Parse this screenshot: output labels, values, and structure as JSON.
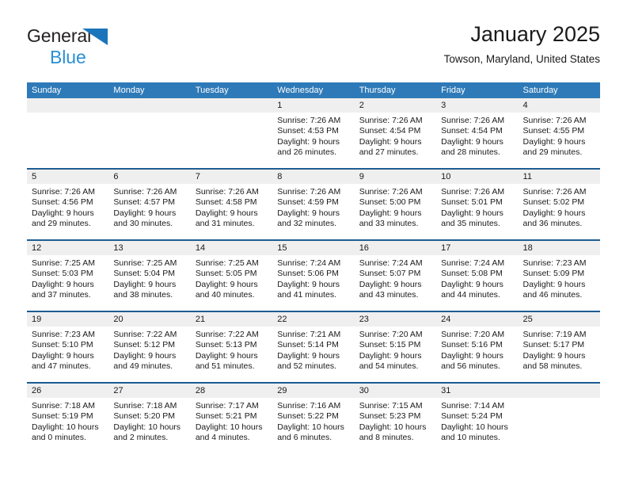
{
  "brand": {
    "word1": "General",
    "word2": "Blue",
    "triangle_color": "#1b75bb",
    "blue_text_color": "#2a8fd4"
  },
  "header": {
    "title": "January 2025",
    "subtitle": "Towson, Maryland, United States"
  },
  "colors": {
    "header_blue": "#2e7ab8",
    "row_divider": "#1f5c91",
    "date_strip_gray": "#efeff0",
    "text": "#1a1a1a"
  },
  "weekdays": [
    "Sunday",
    "Monday",
    "Tuesday",
    "Wednesday",
    "Thursday",
    "Friday",
    "Saturday"
  ],
  "weeks": [
    [
      {
        "day": "",
        "lines": []
      },
      {
        "day": "",
        "lines": []
      },
      {
        "day": "",
        "lines": []
      },
      {
        "day": "1",
        "lines": [
          "Sunrise: 7:26 AM",
          "Sunset: 4:53 PM",
          "Daylight: 9 hours",
          "and 26 minutes."
        ]
      },
      {
        "day": "2",
        "lines": [
          "Sunrise: 7:26 AM",
          "Sunset: 4:54 PM",
          "Daylight: 9 hours",
          "and 27 minutes."
        ]
      },
      {
        "day": "3",
        "lines": [
          "Sunrise: 7:26 AM",
          "Sunset: 4:54 PM",
          "Daylight: 9 hours",
          "and 28 minutes."
        ]
      },
      {
        "day": "4",
        "lines": [
          "Sunrise: 7:26 AM",
          "Sunset: 4:55 PM",
          "Daylight: 9 hours",
          "and 29 minutes."
        ]
      }
    ],
    [
      {
        "day": "5",
        "lines": [
          "Sunrise: 7:26 AM",
          "Sunset: 4:56 PM",
          "Daylight: 9 hours",
          "and 29 minutes."
        ]
      },
      {
        "day": "6",
        "lines": [
          "Sunrise: 7:26 AM",
          "Sunset: 4:57 PM",
          "Daylight: 9 hours",
          "and 30 minutes."
        ]
      },
      {
        "day": "7",
        "lines": [
          "Sunrise: 7:26 AM",
          "Sunset: 4:58 PM",
          "Daylight: 9 hours",
          "and 31 minutes."
        ]
      },
      {
        "day": "8",
        "lines": [
          "Sunrise: 7:26 AM",
          "Sunset: 4:59 PM",
          "Daylight: 9 hours",
          "and 32 minutes."
        ]
      },
      {
        "day": "9",
        "lines": [
          "Sunrise: 7:26 AM",
          "Sunset: 5:00 PM",
          "Daylight: 9 hours",
          "and 33 minutes."
        ]
      },
      {
        "day": "10",
        "lines": [
          "Sunrise: 7:26 AM",
          "Sunset: 5:01 PM",
          "Daylight: 9 hours",
          "and 35 minutes."
        ]
      },
      {
        "day": "11",
        "lines": [
          "Sunrise: 7:26 AM",
          "Sunset: 5:02 PM",
          "Daylight: 9 hours",
          "and 36 minutes."
        ]
      }
    ],
    [
      {
        "day": "12",
        "lines": [
          "Sunrise: 7:25 AM",
          "Sunset: 5:03 PM",
          "Daylight: 9 hours",
          "and 37 minutes."
        ]
      },
      {
        "day": "13",
        "lines": [
          "Sunrise: 7:25 AM",
          "Sunset: 5:04 PM",
          "Daylight: 9 hours",
          "and 38 minutes."
        ]
      },
      {
        "day": "14",
        "lines": [
          "Sunrise: 7:25 AM",
          "Sunset: 5:05 PM",
          "Daylight: 9 hours",
          "and 40 minutes."
        ]
      },
      {
        "day": "15",
        "lines": [
          "Sunrise: 7:24 AM",
          "Sunset: 5:06 PM",
          "Daylight: 9 hours",
          "and 41 minutes."
        ]
      },
      {
        "day": "16",
        "lines": [
          "Sunrise: 7:24 AM",
          "Sunset: 5:07 PM",
          "Daylight: 9 hours",
          "and 43 minutes."
        ]
      },
      {
        "day": "17",
        "lines": [
          "Sunrise: 7:24 AM",
          "Sunset: 5:08 PM",
          "Daylight: 9 hours",
          "and 44 minutes."
        ]
      },
      {
        "day": "18",
        "lines": [
          "Sunrise: 7:23 AM",
          "Sunset: 5:09 PM",
          "Daylight: 9 hours",
          "and 46 minutes."
        ]
      }
    ],
    [
      {
        "day": "19",
        "lines": [
          "Sunrise: 7:23 AM",
          "Sunset: 5:10 PM",
          "Daylight: 9 hours",
          "and 47 minutes."
        ]
      },
      {
        "day": "20",
        "lines": [
          "Sunrise: 7:22 AM",
          "Sunset: 5:12 PM",
          "Daylight: 9 hours",
          "and 49 minutes."
        ]
      },
      {
        "day": "21",
        "lines": [
          "Sunrise: 7:22 AM",
          "Sunset: 5:13 PM",
          "Daylight: 9 hours",
          "and 51 minutes."
        ]
      },
      {
        "day": "22",
        "lines": [
          "Sunrise: 7:21 AM",
          "Sunset: 5:14 PM",
          "Daylight: 9 hours",
          "and 52 minutes."
        ]
      },
      {
        "day": "23",
        "lines": [
          "Sunrise: 7:20 AM",
          "Sunset: 5:15 PM",
          "Daylight: 9 hours",
          "and 54 minutes."
        ]
      },
      {
        "day": "24",
        "lines": [
          "Sunrise: 7:20 AM",
          "Sunset: 5:16 PM",
          "Daylight: 9 hours",
          "and 56 minutes."
        ]
      },
      {
        "day": "25",
        "lines": [
          "Sunrise: 7:19 AM",
          "Sunset: 5:17 PM",
          "Daylight: 9 hours",
          "and 58 minutes."
        ]
      }
    ],
    [
      {
        "day": "26",
        "lines": [
          "Sunrise: 7:18 AM",
          "Sunset: 5:19 PM",
          "Daylight: 10 hours",
          "and 0 minutes."
        ]
      },
      {
        "day": "27",
        "lines": [
          "Sunrise: 7:18 AM",
          "Sunset: 5:20 PM",
          "Daylight: 10 hours",
          "and 2 minutes."
        ]
      },
      {
        "day": "28",
        "lines": [
          "Sunrise: 7:17 AM",
          "Sunset: 5:21 PM",
          "Daylight: 10 hours",
          "and 4 minutes."
        ]
      },
      {
        "day": "29",
        "lines": [
          "Sunrise: 7:16 AM",
          "Sunset: 5:22 PM",
          "Daylight: 10 hours",
          "and 6 minutes."
        ]
      },
      {
        "day": "30",
        "lines": [
          "Sunrise: 7:15 AM",
          "Sunset: 5:23 PM",
          "Daylight: 10 hours",
          "and 8 minutes."
        ]
      },
      {
        "day": "31",
        "lines": [
          "Sunrise: 7:14 AM",
          "Sunset: 5:24 PM",
          "Daylight: 10 hours",
          "and 10 minutes."
        ]
      },
      {
        "day": "",
        "lines": []
      }
    ]
  ]
}
